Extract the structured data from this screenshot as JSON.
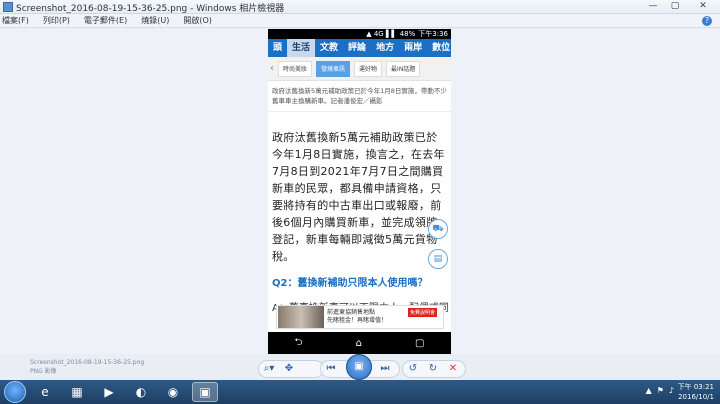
{
  "window": {
    "title": "Screenshot_2016-08-19-15-36-25.png - Windows 相片檢視器",
    "minimize": "—",
    "maximize": "▢",
    "close": "✕"
  },
  "menu": {
    "items": [
      "檔案(F)",
      "列印(P)",
      "電子郵件(E)",
      "燒錄(U)",
      "開啟(O)"
    ],
    "help": "?"
  },
  "phone": {
    "status": {
      "signal": "▲ 4G ▌▌",
      "battery": "48%",
      "time": "下午3:36"
    },
    "nav_tabs": [
      "頭",
      "生活",
      "文教",
      "評論",
      "地方",
      "兩岸",
      "數位"
    ],
    "nav_active_index": 1,
    "sub_tabs": [
      "時尚美妝",
      "發燒車訊",
      "運好物",
      "最IN話題"
    ],
    "sub_active_index": 1,
    "caption": "政府汰舊換新5萬元補助政策已於今年1月8日實施，帶動不少舊車車主換購新車。記者潘俊宏／攝影",
    "article": "政府汰舊換新5萬元補助政策已於今年1月8日實施，換言之，在去年7月8日到2021年7月7日之間購買新車的民眾，都具備申請資格，只要將持有的中古車出口或報廢，前後6個月內購買新車，並完成領牌登記，新車每輛即減徵5萬元貨物稅。",
    "question": "Q2：舊換新補助只限本人使用嗎？",
    "answer": "A：舊車換新車可以不限本人，配偶或同",
    "ad": {
      "line1": "前進東協銷售地點",
      "line2": "先睹租金！再睹增值！",
      "badge": "免費說明會"
    },
    "android_nav": [
      "⮌",
      "⌂",
      "▢"
    ]
  },
  "file_info": {
    "name": "Screenshot_2016-08-19-15-36-25.png",
    "size": "PNG 影像"
  },
  "toolbar": {
    "zoom": "⌕▾",
    "fit": "✥",
    "prev": "⏮",
    "play": "▣",
    "next": "⏭",
    "rotate_left": "↺",
    "rotate_right": "↻",
    "delete": "✕"
  },
  "taskbar": {
    "tasks": [
      "e",
      "▦",
      "▶",
      "◐",
      "◉",
      "▣"
    ],
    "tray_icons": [
      "▲",
      "⚑",
      "♪"
    ],
    "time": "下午 03:21",
    "date": "2016/10/1"
  },
  "colors": {
    "nav_blue": "#1b6fc4",
    "active_subtab": "#5aa0e6",
    "question_blue": "#1b6fc4",
    "delete_red": "#d23b3b"
  }
}
